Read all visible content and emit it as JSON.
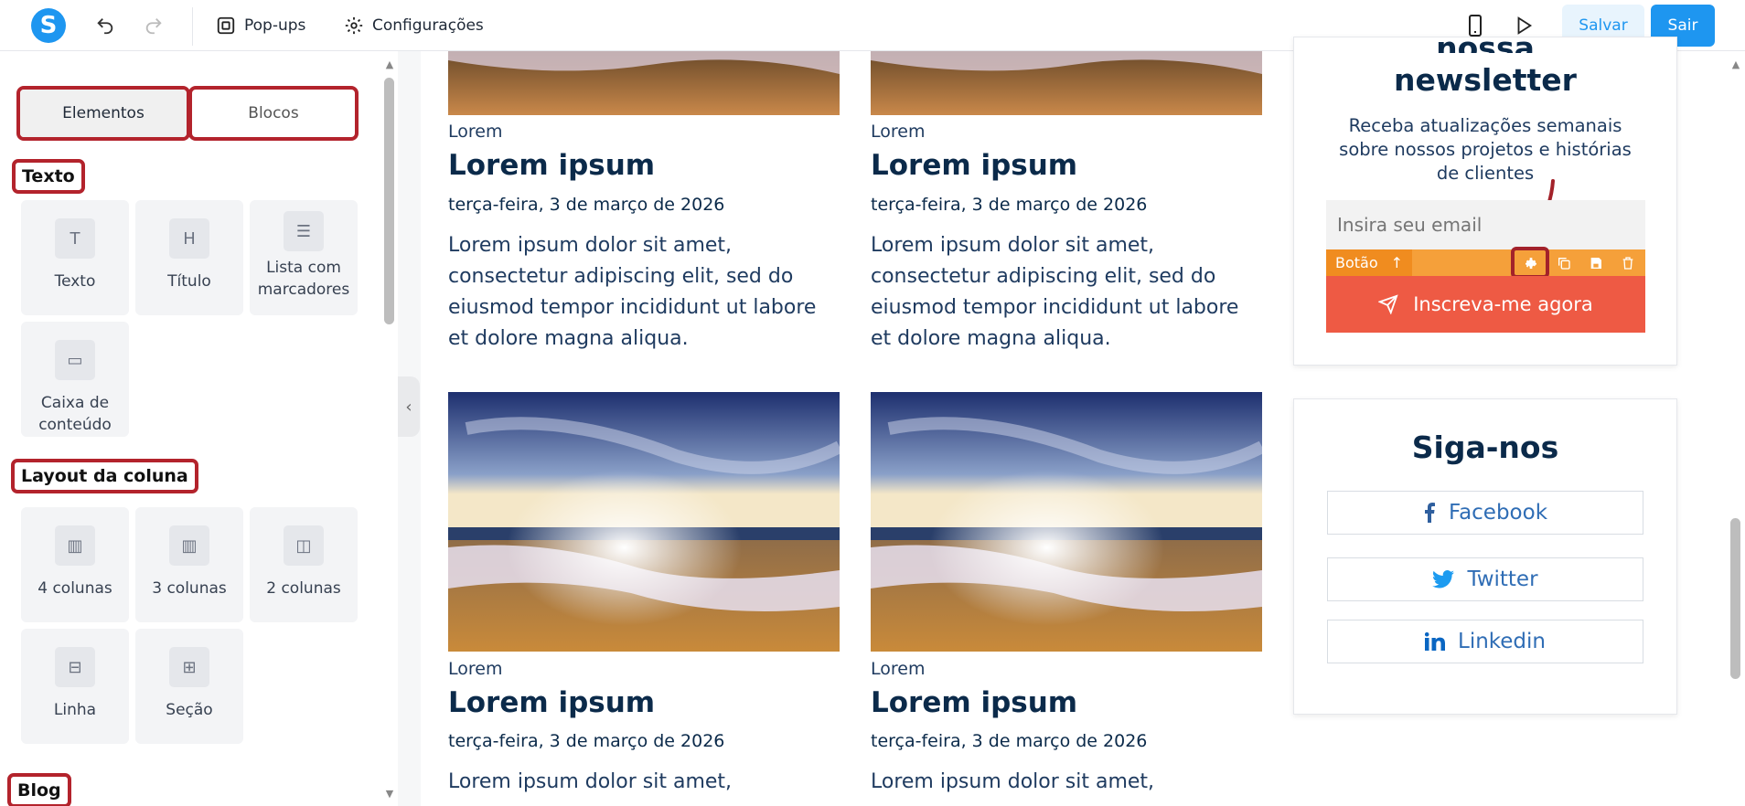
{
  "topbar": {
    "popups_label": "Pop-ups",
    "config_label": "Configurações",
    "save_label": "Salvar",
    "exit_label": "Sair"
  },
  "sidebar": {
    "tabs": [
      {
        "label": "Elementos"
      },
      {
        "label": "Blocos"
      }
    ],
    "sections": [
      {
        "title": "Texto"
      },
      {
        "title": "Layout da coluna"
      },
      {
        "title": "Blog"
      }
    ],
    "text_items": [
      {
        "label": "Texto",
        "icon": "text-icon"
      },
      {
        "label": "Título",
        "icon": "heading-icon"
      },
      {
        "label": "Lista com marcadores",
        "icon": "bullet-list-icon"
      },
      {
        "label": "Caixa de conteúdo",
        "icon": "content-box-icon"
      }
    ],
    "layout_items": [
      {
        "label": "4 colunas",
        "icon": "four-columns-icon"
      },
      {
        "label": "3 colunas",
        "icon": "three-columns-icon"
      },
      {
        "label": "2 colunas",
        "icon": "two-columns-icon"
      },
      {
        "label": "Linha",
        "icon": "row-icon"
      },
      {
        "label": "Seção",
        "icon": "section-icon"
      }
    ]
  },
  "posts": [
    {
      "category": "Lorem",
      "title": "Lorem ipsum",
      "date": "terça-feira, 3 de março de 2026",
      "excerpt": "Lorem ipsum dolor sit amet, consectetur adipiscing elit, sed do eiusmod tempor incididunt ut labore et dolore magna aliqua."
    },
    {
      "category": "Lorem",
      "title": "Lorem ipsum",
      "date": "terça-feira, 3 de março de 2026",
      "excerpt": "Lorem ipsum dolor sit amet, consectetur adipiscing elit, sed do eiusmod tempor incididunt ut labore et dolore magna aliqua."
    },
    {
      "category": "Lorem",
      "title": "Lorem ipsum",
      "date": "terça-feira, 3 de março de 2026",
      "excerpt": "Lorem ipsum dolor sit amet,"
    },
    {
      "category": "Lorem",
      "title": "Lorem ipsum",
      "date": "terça-feira, 3 de março de 2026",
      "excerpt": "Lorem ipsum dolor sit amet,"
    }
  ],
  "newsletter": {
    "title_line1": "nossa",
    "title_line2": "newsletter",
    "subtitle": "Receba atualizações semanais sobre nossos projetos e histórias de clientes",
    "email_placeholder": "Insira seu email",
    "toolbar_label": "Botão",
    "button_label": "Inscreva-me agora"
  },
  "follow": {
    "title": "Siga-nos",
    "links": [
      {
        "label": "Facebook",
        "icon": "facebook-icon"
      },
      {
        "label": "Twitter",
        "icon": "twitter-icon"
      },
      {
        "label": "Linkedin",
        "icon": "linkedin-icon"
      }
    ]
  },
  "colors": {
    "brand_blue": "#1e96f0",
    "highlight_red": "#b3232c",
    "cta_orange": "#ee5a44",
    "toolbar_orange": "#f5a03a",
    "navy_text": "#0b2a4a"
  }
}
